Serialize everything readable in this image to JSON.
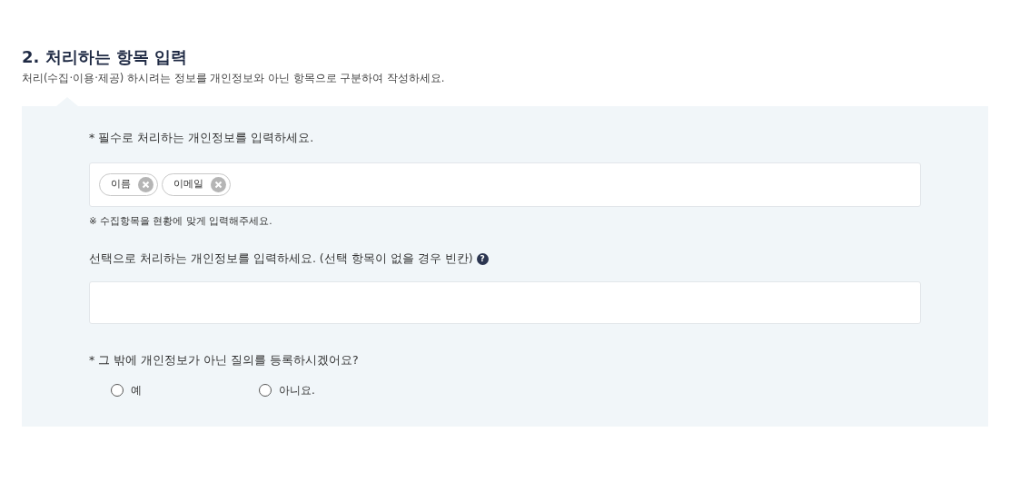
{
  "section": {
    "title": "2. 처리하는 항목 입력",
    "description": "처리(수집·이용·제공) 하시려는 정보를 개인정보와 아닌 항목으로 구분하여 작성하세요."
  },
  "required": {
    "label": "* 필수로 처리하는 개인정보를 입력하세요.",
    "tags": [
      {
        "text": "이름"
      },
      {
        "text": "이메일"
      }
    ],
    "note": "※ 수집항목을 현황에 맞게 입력해주세요."
  },
  "optional": {
    "label": "선택으로 처리하는 개인정보를 입력하세요. (선택 항목이 없을 경우 빈칸)",
    "help": "?"
  },
  "question": {
    "label": "* 그 밖에 개인정보가 아닌 질의를 등록하시겠어요?",
    "options": [
      {
        "label": "예",
        "selected": false
      },
      {
        "label": "아니요.",
        "selected": false
      }
    ]
  }
}
